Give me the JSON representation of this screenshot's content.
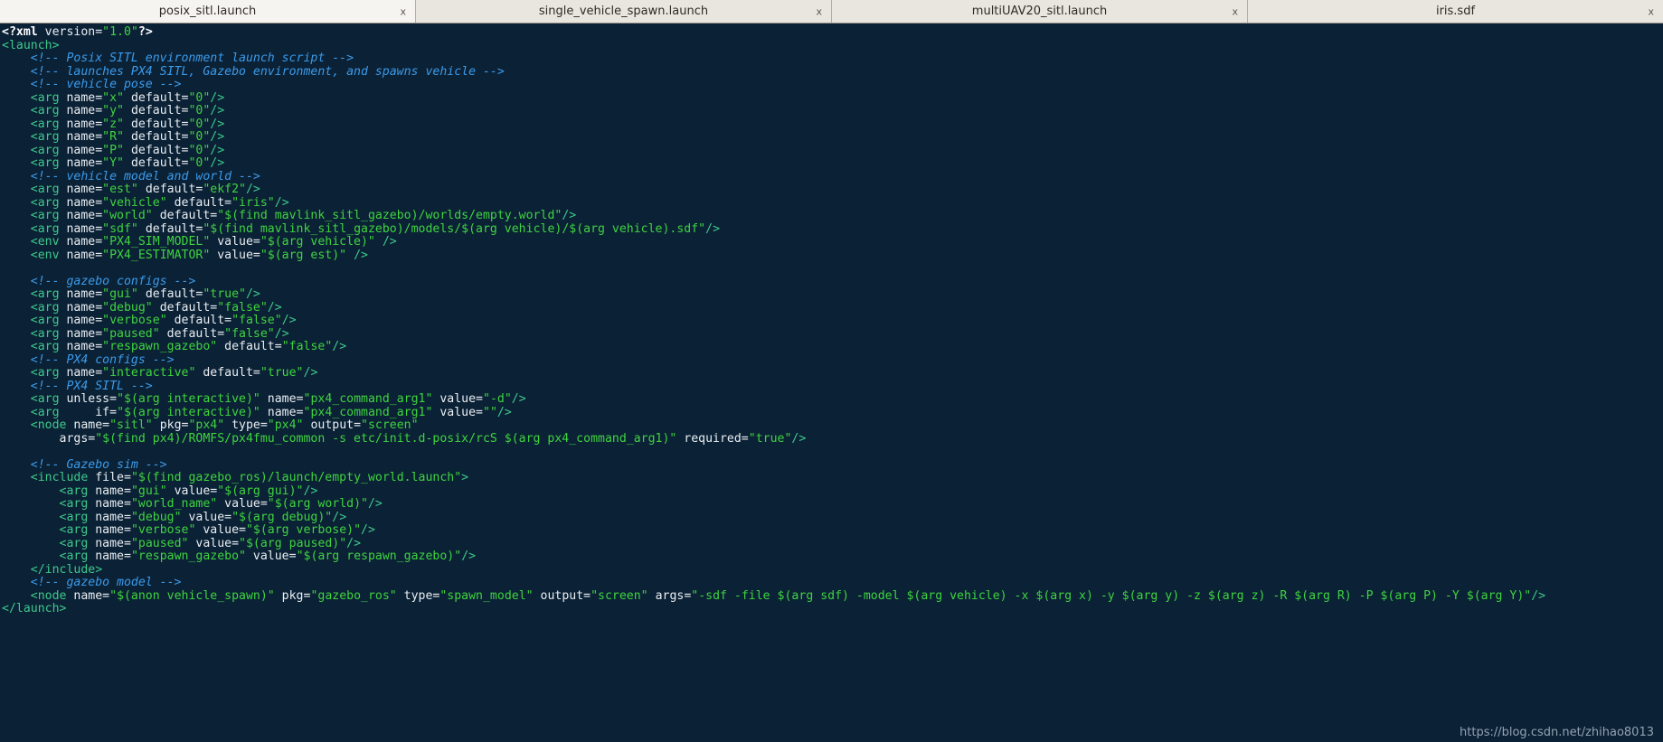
{
  "tabs": [
    {
      "label": "posix_sitl.launch",
      "close": "x",
      "active": true
    },
    {
      "label": "single_vehicle_spawn.launch",
      "close": "x",
      "active": false
    },
    {
      "label": "multiUAV20_sitl.launch",
      "close": "x",
      "active": false
    },
    {
      "label": "iris.sdf",
      "close": "x",
      "active": false
    }
  ],
  "watermark": "https://blog.csdn.net/zhihao8013",
  "colors": {
    "background": "#0b2136",
    "tag": "#3ec98a",
    "value": "#3fd43f",
    "comment": "#3b9bea",
    "plain": "#e9eef2",
    "tabbar": "#d6d2ca",
    "tab_active": "#f6f4f1"
  },
  "editor": {
    "filename": "posix_sitl.launch",
    "language": "xml",
    "caret_line": 23,
    "caret_after_text": "respawn_gazebo",
    "lines": [
      "<?xml version=\"1.0\"?>",
      "<launch>",
      "    <!-- Posix SITL environment launch script -->",
      "    <!-- launches PX4 SITL, Gazebo environment, and spawns vehicle -->",
      "    <!-- vehicle pose -->",
      "    <arg name=\"x\" default=\"0\"/>",
      "    <arg name=\"y\" default=\"0\"/>",
      "    <arg name=\"z\" default=\"0\"/>",
      "    <arg name=\"R\" default=\"0\"/>",
      "    <arg name=\"P\" default=\"0\"/>",
      "    <arg name=\"Y\" default=\"0\"/>",
      "    <!-- vehicle model and world -->",
      "    <arg name=\"est\" default=\"ekf2\"/>",
      "    <arg name=\"vehicle\" default=\"iris\"/>",
      "    <arg name=\"world\" default=\"$(find mavlink_sitl_gazebo)/worlds/empty.world\"/>",
      "    <arg name=\"sdf\" default=\"$(find mavlink_sitl_gazebo)/models/$(arg vehicle)/$(arg vehicle).sdf\"/>",
      "    <env name=\"PX4_SIM_MODEL\" value=\"$(arg vehicle)\" />",
      "    <env name=\"PX4_ESTIMATOR\" value=\"$(arg est)\" />",
      "",
      "    <!-- gazebo configs -->",
      "    <arg name=\"gui\" default=\"true\"/>",
      "    <arg name=\"debug\" default=\"false\"/>",
      "    <arg name=\"verbose\" default=\"false\"/>",
      "    <arg name=\"paused\" default=\"false\"/>",
      "    <arg name=\"respawn_gazebo\" default=\"false\"/>",
      "    <!-- PX4 configs -->",
      "    <arg name=\"interactive\" default=\"true\"/>",
      "    <!-- PX4 SITL -->",
      "    <arg unless=\"$(arg interactive)\" name=\"px4_command_arg1\" value=\"-d\"/>",
      "    <arg     if=\"$(arg interactive)\" name=\"px4_command_arg1\" value=\"\"/>",
      "    <node name=\"sitl\" pkg=\"px4\" type=\"px4\" output=\"screen\"",
      "        args=\"$(find px4)/ROMFS/px4fmu_common -s etc/init.d-posix/rcS $(arg px4_command_arg1)\" required=\"true\"/>",
      "",
      "    <!-- Gazebo sim -->",
      "    <include file=\"$(find gazebo_ros)/launch/empty_world.launch\">",
      "        <arg name=\"gui\" value=\"$(arg gui)\"/>",
      "        <arg name=\"world_name\" value=\"$(arg world)\"/>",
      "        <arg name=\"debug\" value=\"$(arg debug)\"/>",
      "        <arg name=\"verbose\" value=\"$(arg verbose)\"/>",
      "        <arg name=\"paused\" value=\"$(arg paused)\"/>",
      "        <arg name=\"respawn_gazebo\" value=\"$(arg respawn_gazebo)\"/>",
      "    </include>",
      "    <!-- gazebo model -->",
      "    <node name=\"$(anon vehicle_spawn)\" pkg=\"gazebo_ros\" type=\"spawn_model\" output=\"screen\" args=\"-sdf -file $(arg sdf) -model $(arg vehicle) -x $(arg x) -y $(arg y) -z $(arg z) -R $(arg R) -P $(arg P) -Y $(arg Y)\"/>",
      "</launch>"
    ]
  }
}
